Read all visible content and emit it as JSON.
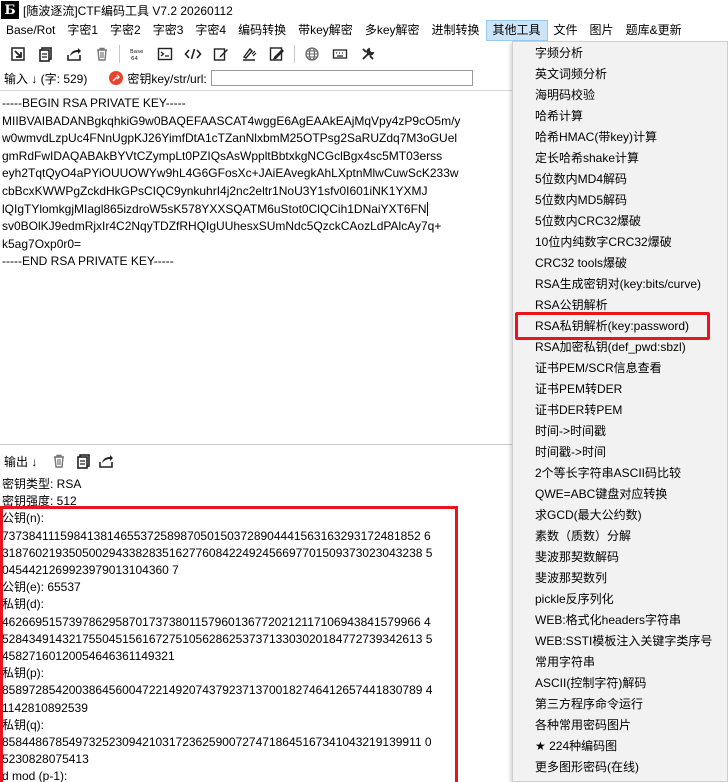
{
  "window": {
    "title": "[随波逐流]CTF编码工具 V7.2  20260112",
    "icon_text": "Б"
  },
  "menubar": {
    "items": [
      "Base/Rot",
      "字密1",
      "字密2",
      "字密3",
      "字密4",
      "编码转换",
      "带key解密",
      "多key解密",
      "进制转换",
      "其他工具",
      "文件",
      "图片",
      "题库&更新"
    ]
  },
  "input": {
    "label": "输入 ↓ (字: 529)",
    "key_label": "密钥key/str/url:",
    "key_value": "",
    "lines": [
      "-----BEGIN RSA PRIVATE KEY-----",
      "MIIBVAIBADANBgkqhkiG9w0BAQEFAASCAT4wggE6AgEAAkEAjMqVpy4zP9cO5m/y",
      "w0wmvdLzpUc4FNnUgpKJ26YimfDtA1cTZanNlxbmM25OTPsg2SaRUZdq7M3oGUel",
      "gmRdFwIDAQABAkBYVtCZympLt0PZIQsAsWppltBbtxkgNCGclBgx4sc5MT03erss",
      "eyh2TqtQyO4aPYiOUUOWYw9hL4G6GFosXc+JAiEAvegkAhLXptnMlwCuwScK233w",
      "cbBcxKWWPgZckdHkGPsCIQC9ynkuhrI4j2nc2eltr1NoU3Y1sfv0I601iNK1YXMJ",
      "lQIgTYlomkgjMIagl865izdroW5sK578YXXSQATM6uStot0ClQCih1DNaiYXT6FN",
      "sv0BOlKJ9edmRjxIr4C2NqyTDZfRHQIgUUhesxSUmNdc5QzckCAozLdPAlcAy7q+",
      "k5ag7Oxp0r0=",
      "-----END RSA PRIVATE KEY-----"
    ]
  },
  "output": {
    "label": "输出 ↓",
    "lines": [
      "密钥类型: RSA",
      "密钥强度: 512",
      "公钥(n):",
      "737384111598413814655372589870501503728904441563163293172481852 6",
      "318760219350500294338283516277608422492456697701509373023043238 5",
      "0454421269923979013104360 7",
      "公钥(e): 65537",
      "私钥(d):",
      "462669515739786295870173738011579601367720212117106943841579966 4",
      "528434914321755045156167275105628625373713303020184772739342613 5",
      "45827160120054646361149321",
      "私钥(p):",
      "858972854200386456004722149207437923713700182746412657441830789 4",
      "1142810892539",
      "私钥(q):",
      "858448678549732523094210317236259007274718645167341043219139911 0",
      "5230828075413",
      "d mod (p-1):"
    ]
  },
  "dropdown": {
    "items": [
      "字频分析",
      "英文词频分析",
      "海明码校验",
      "哈希计算",
      "哈希HMAC(带key)计算",
      "定长哈希shake计算",
      "5位数内MD4解码",
      "5位数内MD5解码",
      "5位数内CRC32爆破",
      "10位内纯数字CRC32爆破",
      "CRC32 tools爆破",
      "RSA生成密钥对(key:bits/curve)",
      "RSA公钥解析",
      "RSA私钥解析(key:password)",
      "RSA加密私钥(def_pwd:sbzl)",
      "证书PEM/SCR信息查看",
      "证书PEM转DER",
      "证书DER转PEM",
      "时间->时间戳",
      "时间戳->时间",
      "2个等长字符串ASCII码比较",
      "QWE=ABC键盘对应转换",
      "求GCD(最大公约数)",
      "素数（质数）分解",
      "斐波那契数解码",
      "斐波那契数列",
      "pickle反序列化",
      "WEB:格式化headers字符串",
      "WEB:SSTI模板注入关键字类序号",
      "常用字符串",
      "ASCII(控制字符)解码",
      "第三方程序命令运行",
      "各种常用密码图片",
      "★ 224种编码图",
      "更多图形密码(在线)"
    ]
  },
  "colors": {
    "highlight": "#e8141e",
    "menu_active": "#cce4f7",
    "dropdown_bg": "#f2f2f2"
  }
}
